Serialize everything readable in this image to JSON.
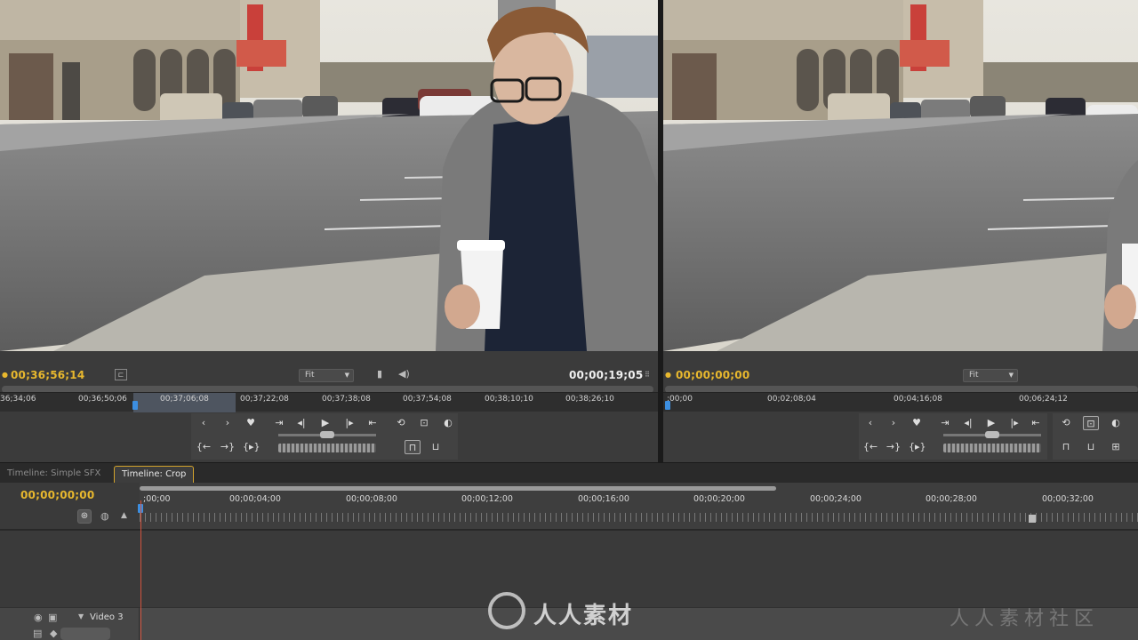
{
  "source_monitor": {
    "timecode_in": "00;36;56;14",
    "timecode_duration": "00;00;19;05",
    "zoom": "Fit",
    "ruler_ticks": [
      "36;34;06",
      "00;36;50;06",
      "00;37;06;08",
      "00;37;22;08",
      "00;37;38;08",
      "00;37;54;08",
      "00;38;10;10",
      "00;38;26;10"
    ]
  },
  "program_monitor": {
    "timecode": "00;00;00;00",
    "zoom": "Fit",
    "ruler_ticks": [
      ";00;00",
      "00;02;08;04",
      "00;04;16;08",
      "00;06;24;12"
    ]
  },
  "timeline": {
    "tabs": [
      "Timeline: Simple SFX",
      "Timeline: Crop"
    ],
    "active_tab": "Timeline: Crop",
    "timecode": "00;00;00;00",
    "ruler_ticks": [
      ";00;00",
      "00;00;04;00",
      "00;00;08;00",
      "00;00;12;00",
      "00;00;16;00",
      "00;00;20;00",
      "00;00;24;00",
      "00;00;28;00",
      "00;00;32;00"
    ],
    "track_name": "Video 3"
  },
  "watermark": {
    "brand": "人人素材",
    "corner": "人人素材社区"
  },
  "colors": {
    "timecode_accent": "#e8b82e",
    "active_tab_border": "#d3a32c",
    "playhead": "#d2533e",
    "marker_blue": "#3c8ee0"
  }
}
